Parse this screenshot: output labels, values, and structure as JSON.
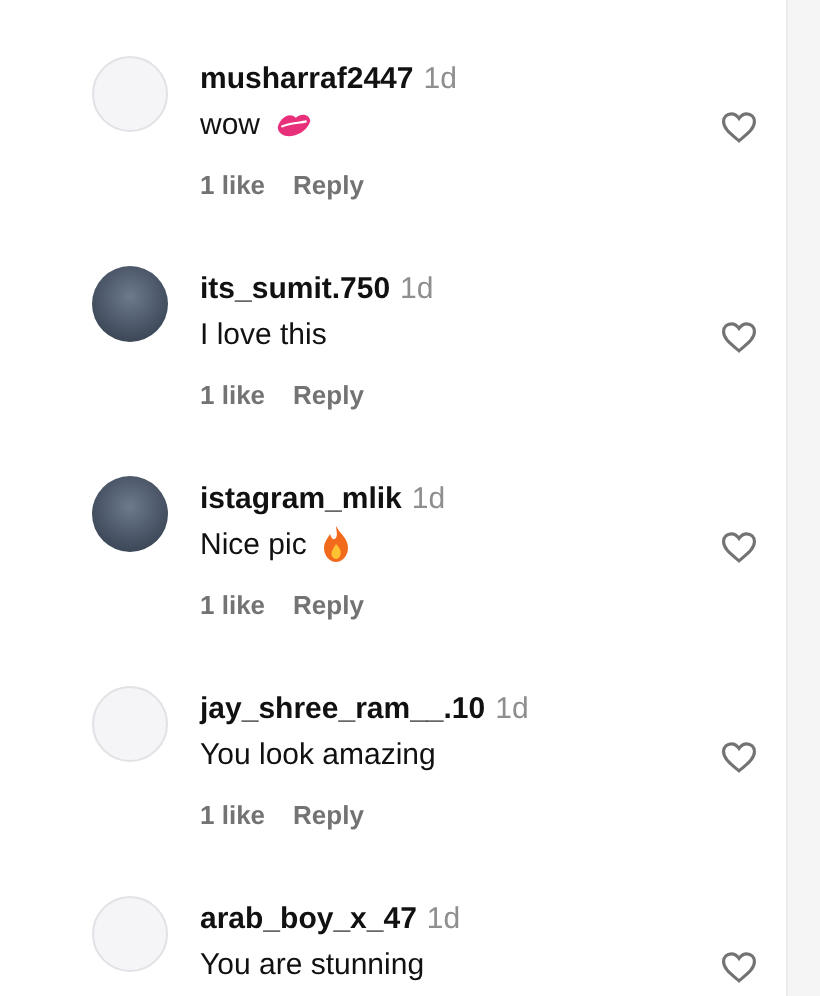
{
  "comments": [
    {
      "username": "musharraf2447",
      "time": "1d",
      "avatar": {
        "kind": "blank"
      },
      "text": "wow",
      "emoji": {
        "kind": "kiss"
      },
      "likes": "1 like",
      "reply": "Reply"
    },
    {
      "username": "its_sumit.750",
      "time": "1d",
      "avatar": {
        "kind": "photo"
      },
      "text": "I love this",
      "likes": "1 like",
      "reply": "Reply"
    },
    {
      "username": "istagram_mlik",
      "time": "1d",
      "avatar": {
        "kind": "photo"
      },
      "text": "Nice pic",
      "emoji": {
        "kind": "fire"
      },
      "likes": "1 like",
      "reply": "Reply"
    },
    {
      "username": "jay_shree_ram__.10",
      "time": "1d",
      "avatar": {
        "kind": "blank"
      },
      "text": "You look amazing",
      "likes": "1 like",
      "reply": "Reply"
    },
    {
      "username": "arab_boy_x_47",
      "time": "1d",
      "avatar": {
        "kind": "blank"
      },
      "text": "You are stunning"
    }
  ]
}
